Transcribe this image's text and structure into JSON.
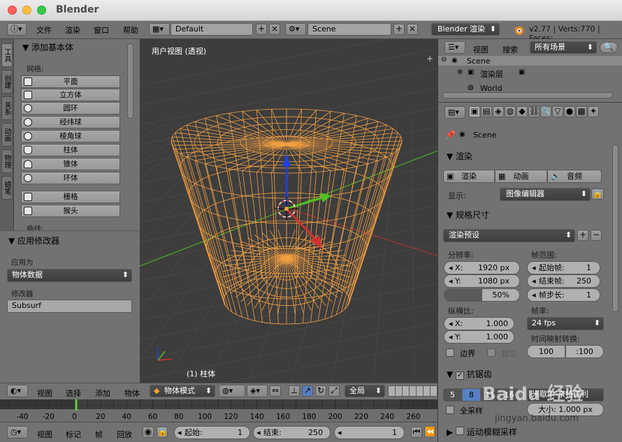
{
  "window": {
    "title": "Blender"
  },
  "top_header": {
    "menus": [
      "文件",
      "渲染",
      "窗口",
      "帮助"
    ],
    "screen_layout": "Default",
    "scene": "Scene",
    "render_engine": "Blender 渲染",
    "stats": "v2.77 | Verts:770 | Faces:"
  },
  "tool_shelf": {
    "tabs": [
      "工具",
      "创建",
      "关系",
      "动画",
      "物理",
      "蜡笔"
    ],
    "panel_title": "添加基本体",
    "mesh_label": "网格:",
    "mesh_items": [
      "平面",
      "立方体",
      "圆环",
      "经纬球",
      "棱角球",
      "柱体",
      "锥体",
      "环体"
    ],
    "extra_items": [
      "栅格",
      "猴头"
    ],
    "curve_label": "曲线:"
  },
  "modifier_panel": {
    "title": "应用修改器",
    "apply_as_label": "应用为",
    "apply_as_value": "物体数据",
    "modifier_label": "修改器",
    "modifier_value": "Subsurf"
  },
  "viewport": {
    "view_name": "用户视图 (透视)",
    "object_label": "(1) 柱体"
  },
  "outliner": {
    "view_menu": "视图",
    "search_menu": "搜索",
    "filter": "所有场景",
    "tree": [
      "Scene",
      "渲染层",
      "World"
    ]
  },
  "properties": {
    "context": "Scene",
    "render_panel": "渲染",
    "render_btn": "渲染",
    "anim_btn": "动画",
    "audio_btn": "音频",
    "display_label": "显示:",
    "display_value": "图像编辑器",
    "dimensions_panel": "规格尺寸",
    "preset": "渲染预设",
    "resolution_label": "分辨率:",
    "res_x_label": "X:",
    "res_x": "1920 px",
    "res_y_label": "Y:",
    "res_y": "1080 px",
    "res_pct": "50%",
    "frame_range_label": "帧范围:",
    "start_frame_label": "起始帧:",
    "start_frame": "1",
    "end_frame_label": "结束帧:",
    "end_frame": "250",
    "frame_step_label": "帧步长:",
    "frame_step": "1",
    "aspect_label": "纵横比:",
    "aspect_x_label": "X:",
    "aspect_x": "1.000",
    "aspect_y_label": "Y:",
    "aspect_y": "1.000",
    "framerate_label": "帧率:",
    "framerate": "24 fps",
    "border_label": "边界",
    "crop_label": "裁切",
    "time_remap_label": "时间映射转换:",
    "remap_old": "100",
    "remap_new": ":100",
    "aa_panel": "抗锯齿",
    "aa_samples": [
      "5",
      "8",
      "11",
      "16"
    ],
    "aa_filter": "米歇尔-奈特瑞利",
    "full_sample_label": "全采样",
    "filter_size": "大小: 1.000 px",
    "motion_blur_panel": "运动模糊采样"
  },
  "viewport_header": {
    "view": "视图",
    "select": "选择",
    "add": "添加",
    "object": "物体",
    "mode": "物体模式",
    "pivot": "全局"
  },
  "timeline": {
    "ticks": [
      "-40",
      "-20",
      "0",
      "20",
      "40",
      "60",
      "80",
      "100",
      "120",
      "140",
      "160",
      "180",
      "200",
      "220",
      "240",
      "260"
    ],
    "current_frame_value": 1
  },
  "timeline_header": {
    "view": "视图",
    "marker": "标记",
    "frame": "帧",
    "playback": "回放",
    "start_label": "起始:",
    "start": "1",
    "end_label": "结束:",
    "end": "250",
    "current": "1"
  },
  "watermark": {
    "site": "jingyan.baidu.com",
    "brand": "Baidu 经验"
  },
  "colors": {
    "wire": "#f5a041",
    "x_axis": "#d33030",
    "y_axis": "#4ec020",
    "z_axis": "#2040e0",
    "frame_cursor": "#60d040"
  }
}
